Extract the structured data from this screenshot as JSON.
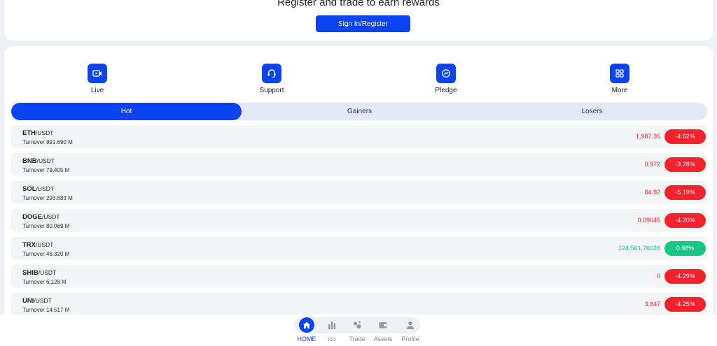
{
  "header": {
    "title": "Register and trade to earn rewards",
    "signin_label": "Sign In/Register"
  },
  "quick_actions": [
    {
      "label": "Live",
      "icon": "video-icon"
    },
    {
      "label": "Support",
      "icon": "headset-icon"
    },
    {
      "label": "Pledge",
      "icon": "pledge-icon"
    },
    {
      "label": "More",
      "icon": "grid-icon"
    }
  ],
  "tabs": [
    {
      "label": "Hot",
      "active": true
    },
    {
      "label": "Gainers",
      "active": false
    },
    {
      "label": "Losers",
      "active": false
    }
  ],
  "rows": [
    {
      "base": "ETH",
      "quote": "/USDT",
      "turnover": "Turnover 891.690 M",
      "price": "1,987.35",
      "change": "-4.62%"
    },
    {
      "base": "BNB",
      "quote": "/USDT",
      "turnover": "Turnover 79.405 M",
      "price": "0.972",
      "change": "-3.28%"
    },
    {
      "base": "SOL",
      "quote": "/USDT",
      "turnover": "Turnover 293.683 M",
      "price": "84.92",
      "change": "-5.19%"
    },
    {
      "base": "DOGE",
      "quote": "/USDT",
      "turnover": "Turnover 80.069 M",
      "price": "0.09045",
      "change": "-4.20%"
    },
    {
      "base": "TRX",
      "quote": "/USDT",
      "turnover": "Turnover 46.320 M",
      "price": "124,561.76026",
      "change": "0.98%"
    },
    {
      "base": "SHIB",
      "quote": "/USDT",
      "turnover": "Turnover 6.128 M",
      "price": "0",
      "change": "-4.29%"
    },
    {
      "base": "UNI",
      "quote": "/USDT",
      "turnover": "Turnover 14.517 M",
      "price": "3.847",
      "change": "-4.25%"
    }
  ],
  "bottom_nav": [
    {
      "label": "HOME",
      "icon": "home-icon",
      "active": true
    },
    {
      "label": "ico",
      "icon": "bar-chart-icon",
      "active": false
    },
    {
      "label": "Trade",
      "icon": "trade-icon",
      "active": false
    },
    {
      "label": "Assets",
      "icon": "wallet-icon",
      "active": false
    },
    {
      "label": "Profile",
      "icon": "user-icon",
      "active": false
    }
  ],
  "colors": {
    "accent": "#0a43f0",
    "negative": "#f5222d",
    "positive": "#14c784"
  }
}
